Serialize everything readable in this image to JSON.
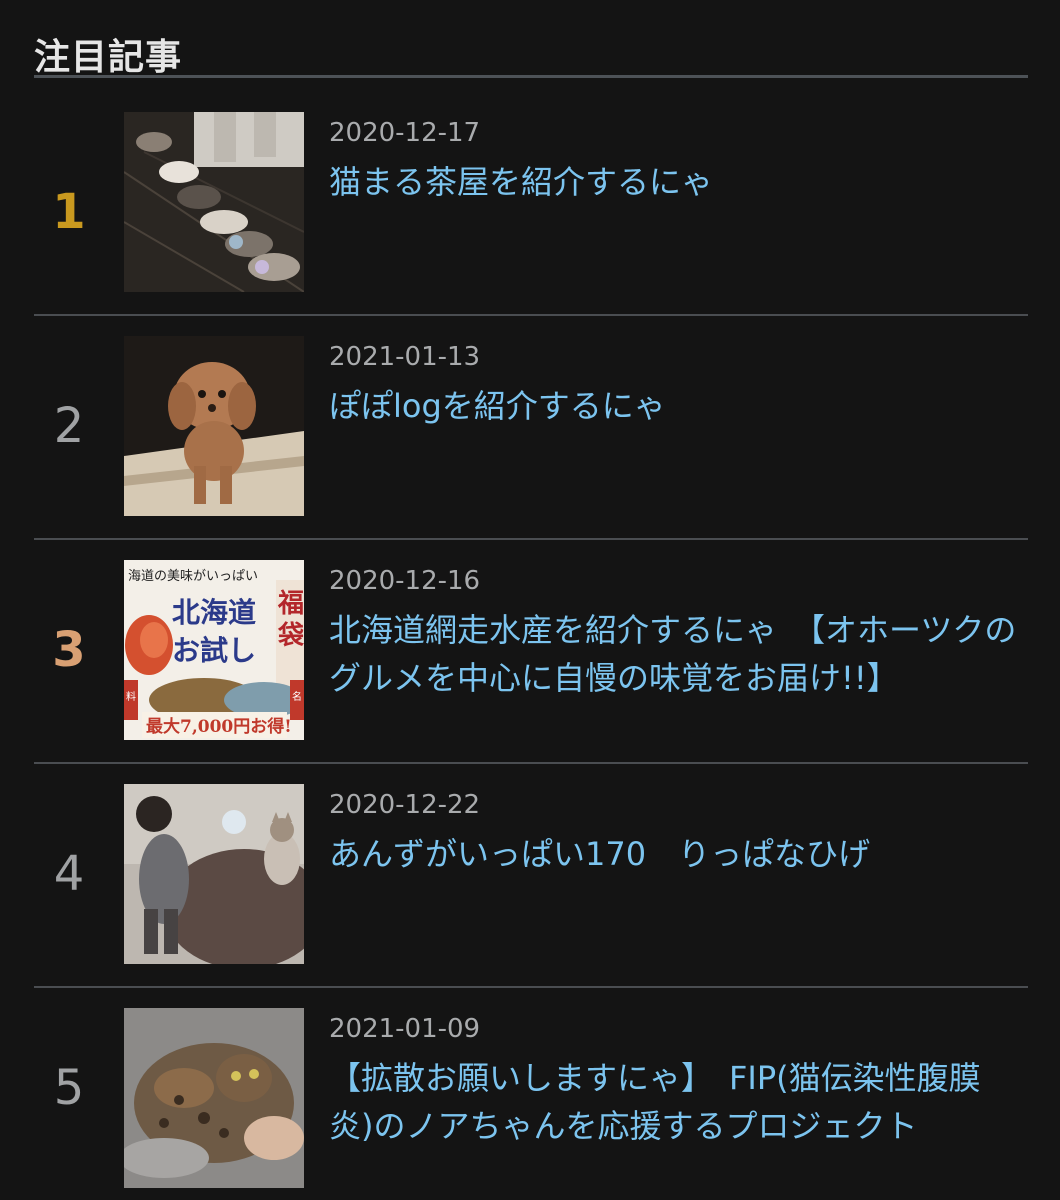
{
  "section": {
    "heading": "注目記事"
  },
  "colors": {
    "background": "#141414",
    "link": "#7cc4ef",
    "date": "#a9abad",
    "rank_gold": "#c9991f",
    "rank_bronze": "#d9a073",
    "rank_default": "#a0a2a4"
  },
  "articles": [
    {
      "rank": "1",
      "date": "2020-12-17",
      "title": "猫まる茶屋を紹介するにゃ",
      "thumbnail": "cats-eating-row-photo"
    },
    {
      "rank": "2",
      "date": "2021-01-13",
      "title": "ぽぽlogを紹介するにゃ",
      "thumbnail": "poodle-dog-photo"
    },
    {
      "rank": "3",
      "date": "2020-12-16",
      "title": "北海道網走水産を紹介するにゃ　【オホーツクのグルメを中心に自慢の味覚をお届け!!】",
      "thumbnail": "hokkaido-seafood-ad",
      "thumb_text": {
        "top": "海道の美味がいっぱい",
        "line1": "北海道",
        "line2": "お試し",
        "side": "福袋",
        "left_tag": "料",
        "right_tag": "名",
        "price": "最大7,000円お得!"
      }
    },
    {
      "rank": "4",
      "date": "2020-12-22",
      "title": "あんずがいっぱい170　りっぱなひげ",
      "thumbnail": "child-and-cat-photo"
    },
    {
      "rank": "5",
      "date": "2021-01-09",
      "title": "【拡散お願いしますにゃ】　FIP(猫伝染性腹膜炎)のノアちゃんを応援するプロジェクト",
      "thumbnail": "bengal-kitten-photo"
    }
  ]
}
